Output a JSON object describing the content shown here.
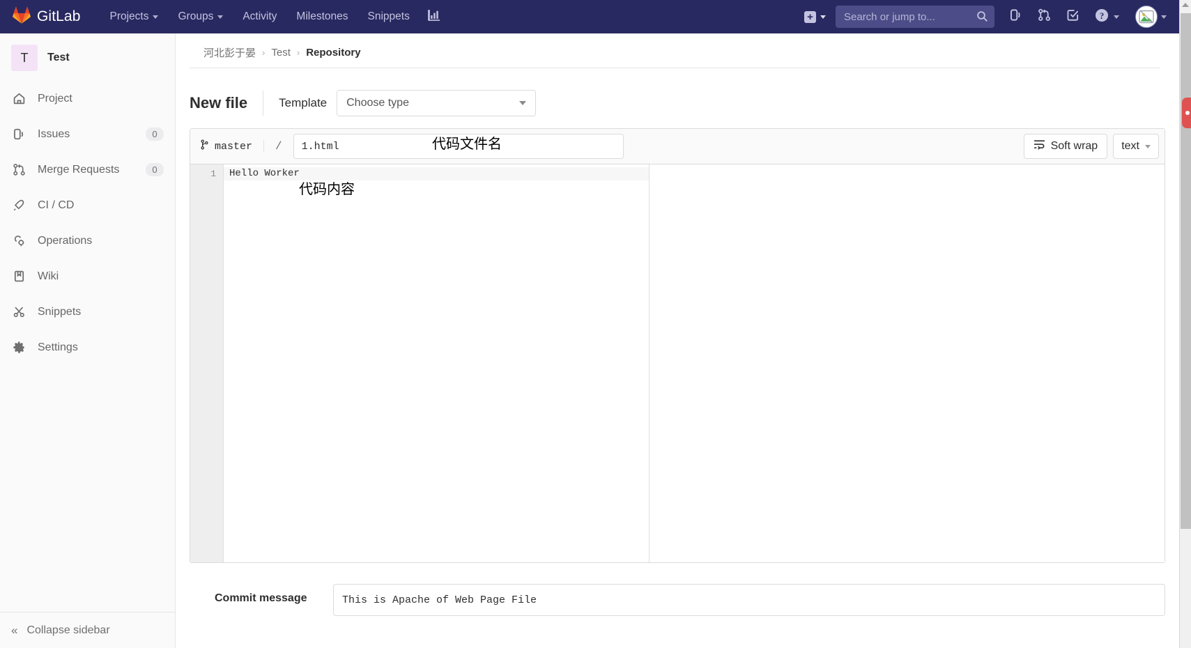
{
  "navbar": {
    "brand": "GitLab",
    "links": [
      {
        "label": "Projects",
        "has_caret": true
      },
      {
        "label": "Groups",
        "has_caret": true
      },
      {
        "label": "Activity",
        "has_caret": false
      },
      {
        "label": "Milestones",
        "has_caret": false
      },
      {
        "label": "Snippets",
        "has_caret": false
      }
    ],
    "analytics_icon": "chart-icon",
    "plus_label": "+",
    "search_placeholder": "Search or jump to...",
    "icons": [
      "issues-icon",
      "merge-requests-icon",
      "todos-icon",
      "help-icon"
    ],
    "avatar_alt": "broken-image-avatar",
    "bg_color": "#292961",
    "link_color": "#c3c3e0"
  },
  "sidebar": {
    "project_initial": "T",
    "project_name": "Test",
    "items": [
      {
        "label": "Project",
        "icon": "home-icon",
        "count": ""
      },
      {
        "label": "Issues",
        "icon": "issues-icon",
        "count": "0"
      },
      {
        "label": "Merge Requests",
        "icon": "merge-requests-icon",
        "count": "0"
      },
      {
        "label": "CI / CD",
        "icon": "rocket-icon",
        "count": ""
      },
      {
        "label": "Operations",
        "icon": "operations-icon",
        "count": ""
      },
      {
        "label": "Wiki",
        "icon": "book-icon",
        "count": ""
      },
      {
        "label": "Snippets",
        "icon": "scissors-icon",
        "count": ""
      },
      {
        "label": "Settings",
        "icon": "gear-icon",
        "count": ""
      }
    ],
    "collapse_label": "Collapse sidebar",
    "collapse_icon": "double-chevron-left-icon"
  },
  "breadcrumb": {
    "group": "河北彭于晏",
    "project": "Test",
    "current": "Repository",
    "separator": "›"
  },
  "page": {
    "title": "New file",
    "template_label": "Template",
    "template_value": "Choose type"
  },
  "editor": {
    "branch": "master",
    "branch_icon": "branch-icon",
    "path_separator": "/",
    "filename_value": "1.html",
    "soft_wrap_label": "Soft wrap",
    "soft_wrap_icon": "soft-wrap-icon",
    "mode_value": "text",
    "line_numbers": [
      "1"
    ],
    "code_lines": [
      "Hello Worker"
    ]
  },
  "annotations": {
    "filename_note": "代码文件名",
    "content_note": "代码内容"
  },
  "commit": {
    "label": "Commit message",
    "value": "This is Apache of Web Page File"
  }
}
